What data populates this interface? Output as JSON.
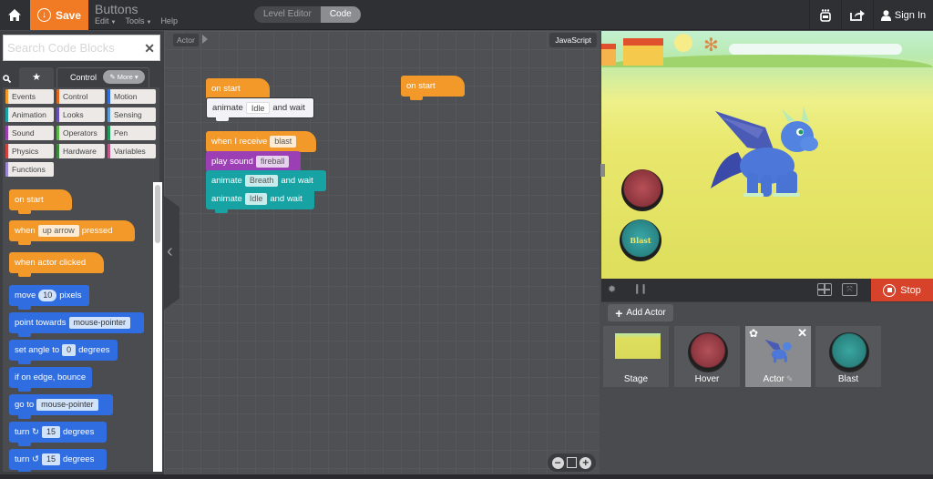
{
  "topbar": {
    "home_icon": "home-icon",
    "save_label": "Save",
    "project_title": "Buttons",
    "menu": [
      {
        "label": "Edit",
        "has_caret": true
      },
      {
        "label": "Tools",
        "has_caret": true
      },
      {
        "label": "Help",
        "has_caret": false
      }
    ],
    "mode_tabs": [
      {
        "label": "Level Editor",
        "active": false
      },
      {
        "label": "Code",
        "active": true
      }
    ],
    "right_icons": [
      "robot-icon",
      "share-icon"
    ],
    "signin_label": "Sign In"
  },
  "palette": {
    "search_placeholder": "Search Code Blocks",
    "search_value": "",
    "favorites_icon": "star-icon",
    "current_tab": "Control",
    "more_label": "More",
    "categories": [
      {
        "label": "Events",
        "color": "#f3992a"
      },
      {
        "label": "Control",
        "color": "#e0661f"
      },
      {
        "label": "Motion",
        "color": "#2f6de1"
      },
      {
        "label": "Animation",
        "color": "#17a3a3"
      },
      {
        "label": "Looks",
        "color": "#6a4fb8"
      },
      {
        "label": "Sensing",
        "color": "#5b9bd8"
      },
      {
        "label": "Sound",
        "color": "#9c3fb5"
      },
      {
        "label": "Operators",
        "color": "#5eb849"
      },
      {
        "label": "Pen",
        "color": "#1f9a5a"
      },
      {
        "label": "Physics",
        "color": "#d2413d"
      },
      {
        "label": "Hardware",
        "color": "#3a8a3a"
      },
      {
        "label": "Variables",
        "color": "#c0578a"
      },
      {
        "label": "Functions",
        "color": "#9b87d4"
      }
    ],
    "blocks": [
      {
        "type": "event",
        "parts": [
          "on start"
        ]
      },
      {
        "type": "event",
        "parts": [
          "when",
          "up arrow",
          "pressed"
        ]
      },
      {
        "type": "event",
        "parts": [
          "when actor clicked"
        ]
      },
      {
        "type": "motion",
        "parts": [
          "move",
          "10",
          "pixels"
        ]
      },
      {
        "type": "motion",
        "parts": [
          "point towards",
          "mouse-pointer"
        ]
      },
      {
        "type": "motion",
        "parts": [
          "set angle to",
          "0",
          "degrees"
        ]
      },
      {
        "type": "motion",
        "parts": [
          "if on edge, bounce"
        ]
      },
      {
        "type": "motion",
        "parts": [
          "go to",
          "mouse-pointer"
        ]
      },
      {
        "type": "motion",
        "parts": [
          "turn ↻",
          "15",
          "degrees"
        ]
      },
      {
        "type": "motion",
        "parts": [
          "turn ↺",
          "15",
          "degrees"
        ]
      }
    ]
  },
  "workspace": {
    "actor_crumb": "Actor",
    "js_label": "JavaScript",
    "scripts": {
      "s1": {
        "hat": "on start",
        "b1": [
          "animate",
          "Idle",
          "and wait"
        ]
      },
      "s2": {
        "hat": [
          "when I receive",
          "blast"
        ],
        "b1": [
          "play sound",
          "fireball"
        ],
        "b2": [
          "animate",
          "Breath",
          "and wait"
        ],
        "b3": [
          "animate",
          "Idle",
          "and wait"
        ]
      },
      "s3": {
        "hat": "on start"
      }
    },
    "zoom_controls": [
      "zoom-out-icon",
      "reset-zoom-icon",
      "zoom-in-icon"
    ]
  },
  "stage": {
    "blast_button_text": "Blast",
    "stop_label": "Stop"
  },
  "actors": {
    "add_label": "Add Actor",
    "items": [
      {
        "label": "Stage",
        "active": false
      },
      {
        "label": "Hover",
        "active": false
      },
      {
        "label": "Actor",
        "active": true
      },
      {
        "label": "Blast",
        "active": false
      }
    ]
  }
}
